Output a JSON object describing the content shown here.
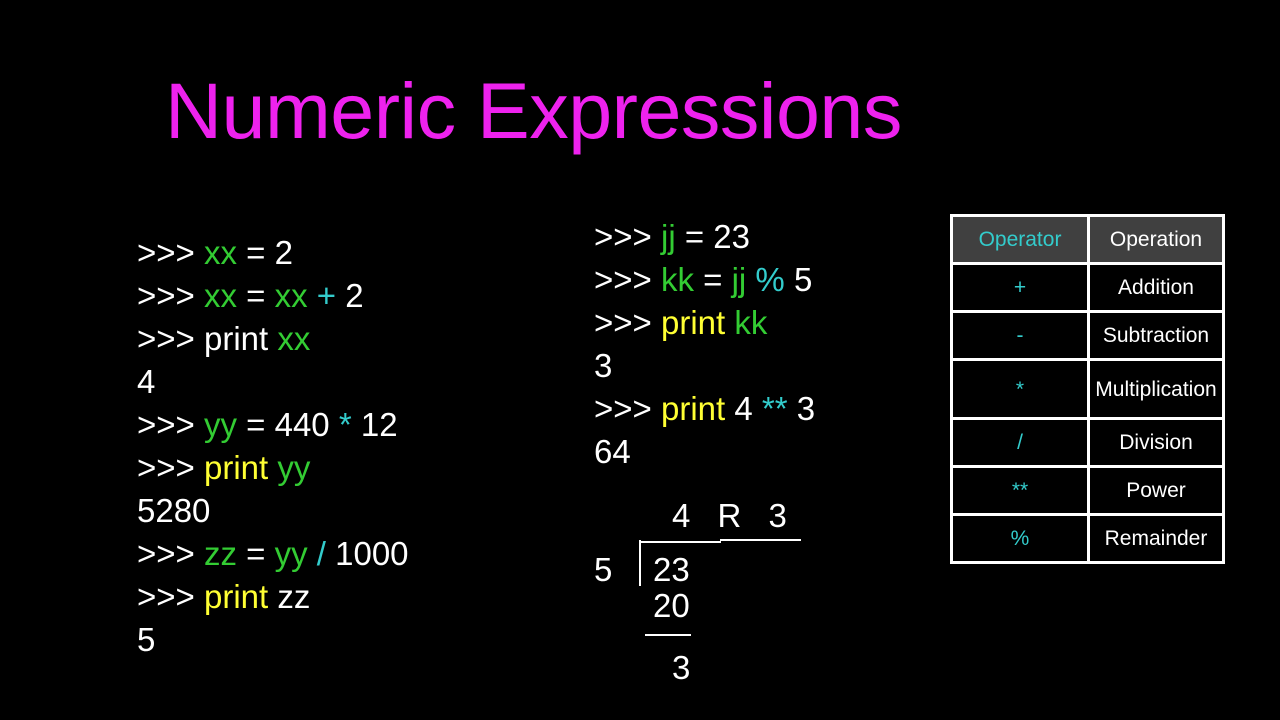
{
  "slide": {
    "title": "Numeric Expressions",
    "colors": {
      "title": "#ee22ee",
      "background": "#000000",
      "default_text": "#ffffff",
      "variable": "#33cc33",
      "keyword": "#ffff33",
      "operator": "#33cccc",
      "table_header_bg": "#404040"
    }
  },
  "left_code": [
    {
      "tokens": [
        {
          "t": ">>> ",
          "c": "white"
        },
        {
          "t": "xx",
          "c": "green"
        },
        {
          "t": " = 2",
          "c": "white"
        }
      ]
    },
    {
      "tokens": [
        {
          "t": ">>> ",
          "c": "white"
        },
        {
          "t": "xx",
          "c": "green"
        },
        {
          "t": " = ",
          "c": "white"
        },
        {
          "t": "xx",
          "c": "green"
        },
        {
          "t": " + ",
          "c": "cyan"
        },
        {
          "t": "2",
          "c": "white"
        }
      ]
    },
    {
      "tokens": [
        {
          "t": ">>> print ",
          "c": "white"
        },
        {
          "t": "xx",
          "c": "green"
        }
      ]
    },
    {
      "tokens": [
        {
          "t": "4",
          "c": "white"
        }
      ]
    },
    {
      "tokens": [
        {
          "t": ">>> ",
          "c": "white"
        },
        {
          "t": "yy",
          "c": "green"
        },
        {
          "t": " = 440 ",
          "c": "white"
        },
        {
          "t": "*",
          "c": "cyan"
        },
        {
          "t": " 12",
          "c": "white"
        }
      ]
    },
    {
      "tokens": [
        {
          "t": ">>> ",
          "c": "white"
        },
        {
          "t": "print",
          "c": "yellow"
        },
        {
          "t": " ",
          "c": "white"
        },
        {
          "t": "yy",
          "c": "green"
        }
      ]
    },
    {
      "tokens": [
        {
          "t": "5280",
          "c": "white"
        }
      ]
    },
    {
      "tokens": [
        {
          "t": ">>> ",
          "c": "white"
        },
        {
          "t": "zz",
          "c": "green"
        },
        {
          "t": " = ",
          "c": "white"
        },
        {
          "t": "yy",
          "c": "green"
        },
        {
          "t": " / ",
          "c": "cyan"
        },
        {
          "t": "1000",
          "c": "white"
        }
      ]
    },
    {
      "tokens": [
        {
          "t": ">>> ",
          "c": "white"
        },
        {
          "t": "print",
          "c": "yellow"
        },
        {
          "t": " zz",
          "c": "white"
        }
      ]
    },
    {
      "tokens": [
        {
          "t": "5",
          "c": "white"
        }
      ]
    }
  ],
  "middle_code": [
    {
      "tokens": [
        {
          "t": ">>> ",
          "c": "white"
        },
        {
          "t": "jj",
          "c": "green"
        },
        {
          "t": " = 23",
          "c": "white"
        }
      ]
    },
    {
      "tokens": [
        {
          "t": ">>> ",
          "c": "white"
        },
        {
          "t": "kk",
          "c": "green"
        },
        {
          "t": " = ",
          "c": "white"
        },
        {
          "t": "jj",
          "c": "green"
        },
        {
          "t": " % ",
          "c": "cyan"
        },
        {
          "t": "5",
          "c": "white"
        }
      ]
    },
    {
      "tokens": [
        {
          "t": ">>> ",
          "c": "white"
        },
        {
          "t": "print",
          "c": "yellow"
        },
        {
          "t": " ",
          "c": "white"
        },
        {
          "t": "kk",
          "c": "green"
        }
      ]
    },
    {
      "tokens": [
        {
          "t": "3",
          "c": "white"
        }
      ]
    },
    {
      "tokens": [
        {
          "t": ">>> ",
          "c": "white"
        },
        {
          "t": "print",
          "c": "yellow"
        },
        {
          "t": " 4 ",
          "c": "white"
        },
        {
          "t": "**",
          "c": "cyan"
        },
        {
          "t": " 3",
          "c": "white"
        }
      ]
    },
    {
      "tokens": [
        {
          "t": "64",
          "c": "white"
        }
      ]
    }
  ],
  "long_division": {
    "quotient": "4 R 3",
    "divisor": "5",
    "dividend": "23",
    "subtrahend": "20",
    "remainder": "3"
  },
  "operator_table": {
    "headers": [
      "Operator",
      "Operation"
    ],
    "rows": [
      {
        "operator": "+",
        "operation": "Addition"
      },
      {
        "operator": "-",
        "operation": "Subtraction"
      },
      {
        "operator": "*",
        "operation": "Multiplication"
      },
      {
        "operator": "/",
        "operation": "Division"
      },
      {
        "operator": "**",
        "operation": "Power"
      },
      {
        "operator": "%",
        "operation": "Remainder"
      }
    ]
  }
}
